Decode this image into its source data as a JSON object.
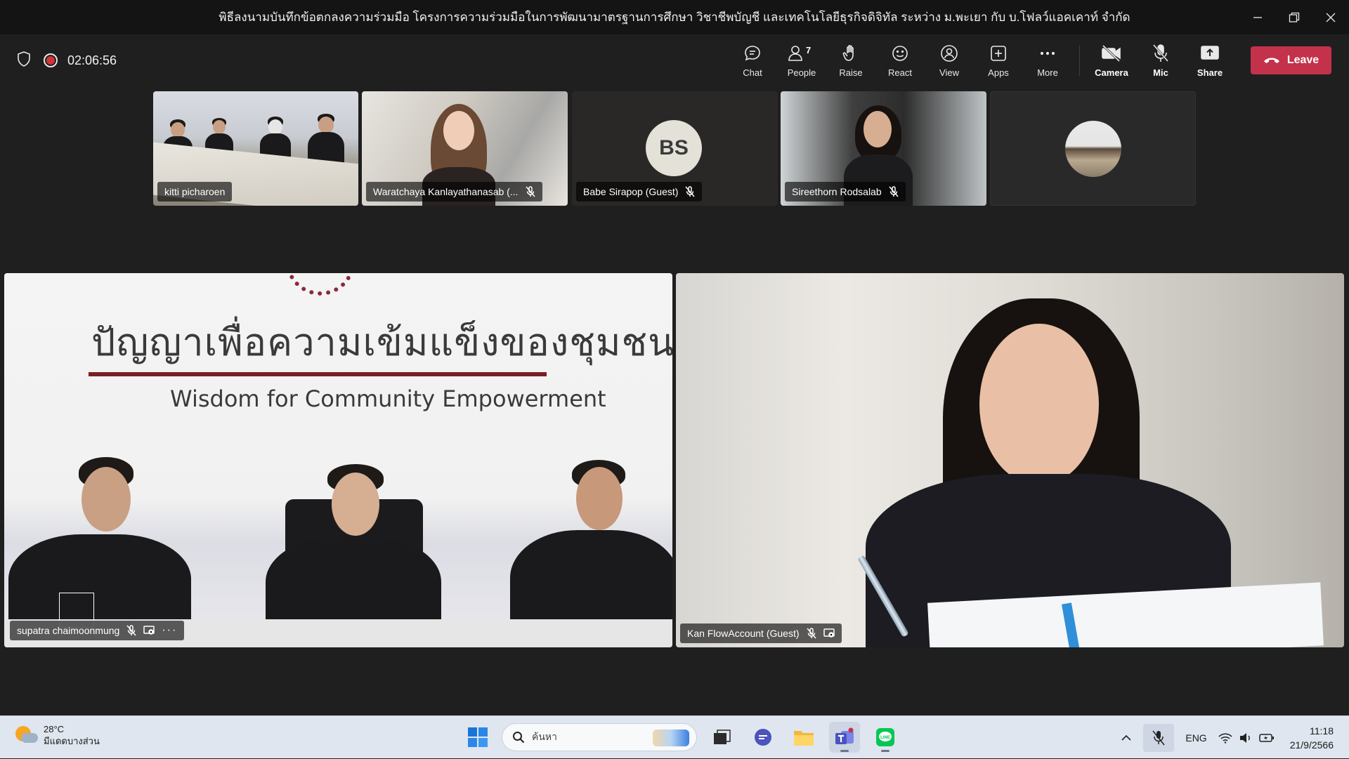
{
  "window": {
    "title": "พิธีลงนามบันทึกข้อตกลงความร่วมมือ โครงการความร่วมมือในการพัฒนามาตรฐานการศึกษา วิชาชีพบัญชี และเทคโนโลยีธุรกิจดิจิทัล ระหว่าง ม.พะเยา กับ บ.โฟลว์แอคเคาท์ จำกัด"
  },
  "meeting": {
    "timer": "02:06:56",
    "people_count": "7",
    "buttons": {
      "chat": "Chat",
      "people": "People",
      "raise": "Raise",
      "react": "React",
      "view": "View",
      "apps": "Apps",
      "more": "More",
      "camera": "Camera",
      "mic": "Mic",
      "share": "Share",
      "leave": "Leave"
    },
    "colors": {
      "leave": "#c4314b",
      "recording": "#d13438"
    }
  },
  "participants_strip": [
    {
      "name": "kitti picharoen"
    },
    {
      "name": "Waratchaya Kanlayathanasab (..."
    },
    {
      "name": "Babe Sirapop (Guest)",
      "initials": "BS"
    },
    {
      "name": "Sireethorn Rodsalab"
    },
    {
      "name": ""
    }
  ],
  "main_tiles": [
    {
      "name": "supatra chaimoonmung",
      "banner_th": "ปัญญาเพื่อความเข้มแข็งของชุมชน",
      "banner_en": "Wisdom for Community Empowerment"
    },
    {
      "name": "Kan FlowAccount (Guest)"
    }
  ],
  "taskbar": {
    "weather_temp": "28°C",
    "weather_desc": "มีแดดบางส่วน",
    "search_placeholder": "ค้นหา",
    "language": "ENG",
    "time": "11:18",
    "date": "21/9/2566"
  }
}
